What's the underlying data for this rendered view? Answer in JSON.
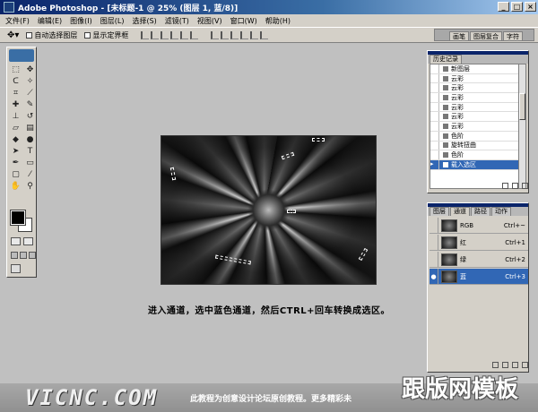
{
  "window": {
    "title": "Adobe Photoshop - [未标题-1 @ 25% (图层 1, 蓝/8)]"
  },
  "menu": [
    "文件(F)",
    "编辑(E)",
    "图像(I)",
    "图层(L)",
    "选择(S)",
    "滤镜(T)",
    "视图(V)",
    "窗口(W)",
    "帮助(H)"
  ],
  "options": {
    "auto_select": "自动选择图层",
    "show_bounds": "显示定界框"
  },
  "palette_well": [
    "画笔",
    "图层复合",
    "字符"
  ],
  "history": {
    "tabs": [
      "历史记录"
    ],
    "items": [
      "新图层",
      "云彩",
      "云彩",
      "云彩",
      "云彩",
      "云彩",
      "云彩",
      "色阶",
      "旋转扭曲",
      "色阶",
      "载入选区"
    ],
    "selected_index": 10
  },
  "channels": {
    "tabs": [
      "图层",
      "通道",
      "路径",
      "动作"
    ],
    "rows": [
      {
        "name": "RGB",
        "shortcut": "Ctrl+~"
      },
      {
        "name": "红",
        "shortcut": "Ctrl+1"
      },
      {
        "name": "绿",
        "shortcut": "Ctrl+2"
      },
      {
        "name": "蓝",
        "shortcut": "Ctrl+3"
      }
    ],
    "selected_index": 3
  },
  "caption": "进入通道，选中蓝色通道，然后CTRL+回车转换成选区。",
  "footer": {
    "site": "VICNC.COM",
    "note": "此教程为创意设计论坛原创教程。更多精彩未",
    "brand": "跟版网模板"
  }
}
